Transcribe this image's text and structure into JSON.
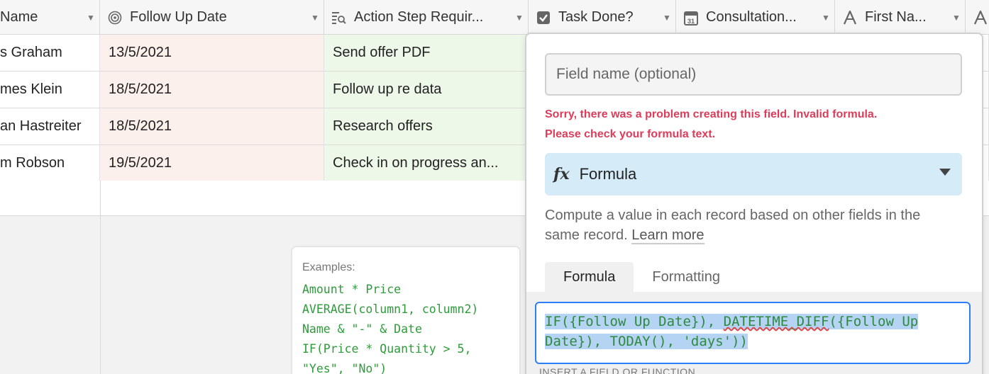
{
  "grid": {
    "columns": [
      {
        "label": "Name",
        "icon": "text-icon"
      },
      {
        "label": "Follow Up Date",
        "icon": "spiral-formula-icon"
      },
      {
        "label": "Action Step Requir...",
        "icon": "lookup-icon"
      },
      {
        "label": "Task Done?",
        "icon": "checkbox-icon"
      },
      {
        "label": "Consultation...",
        "icon": "calendar-icon"
      },
      {
        "label": "First Na...",
        "icon": "letter-a-icon"
      },
      {
        "label": "",
        "icon": "letter-a-icon"
      }
    ],
    "rows": [
      {
        "name": "s Graham",
        "date": "13/5/2021",
        "action": "Send offer PDF"
      },
      {
        "name": "mes Klein",
        "date": "18/5/2021",
        "action": "Follow up re data"
      },
      {
        "name": "an Hastreiter",
        "date": "18/5/2021",
        "action": "Research offers"
      },
      {
        "name": "m Robson",
        "date": "19/5/2021",
        "action": "Check in on progress an..."
      }
    ]
  },
  "examples": {
    "title": "Examples:",
    "lines": [
      "Amount * Price",
      "AVERAGE(column1, column2)",
      "Name & \"-\" & Date",
      "IF(Price * Quantity > 5,",
      "\"Yes\", \"No\")"
    ]
  },
  "panel": {
    "field_name_placeholder": "Field name (optional)",
    "error_line1": "Sorry, there was a problem creating this field. Invalid formula.",
    "error_line2": "Please check your formula text.",
    "field_type": "Formula",
    "description": "Compute a value in each record based on other fields in the same record.",
    "learn_more": "Learn more",
    "tabs": [
      "Formula",
      "Formatting"
    ],
    "formula_part1": "IF({Follow Up Date}), ",
    "formula_func": "DATETIME_DIFF",
    "formula_part2": "({Follow Up Date}), TODAY(), 'days'))",
    "insert_label": "INSERT A FIELD OR FUNCTION"
  },
  "colors": {
    "date_column_bg": "#fbf0eb",
    "action_column_bg": "#eef8e9",
    "error": "#dc3d5b",
    "field_type_bg": "#d5ebf8",
    "editor_border": "#2d7ff9",
    "formula_text": "#2d8a3e"
  }
}
